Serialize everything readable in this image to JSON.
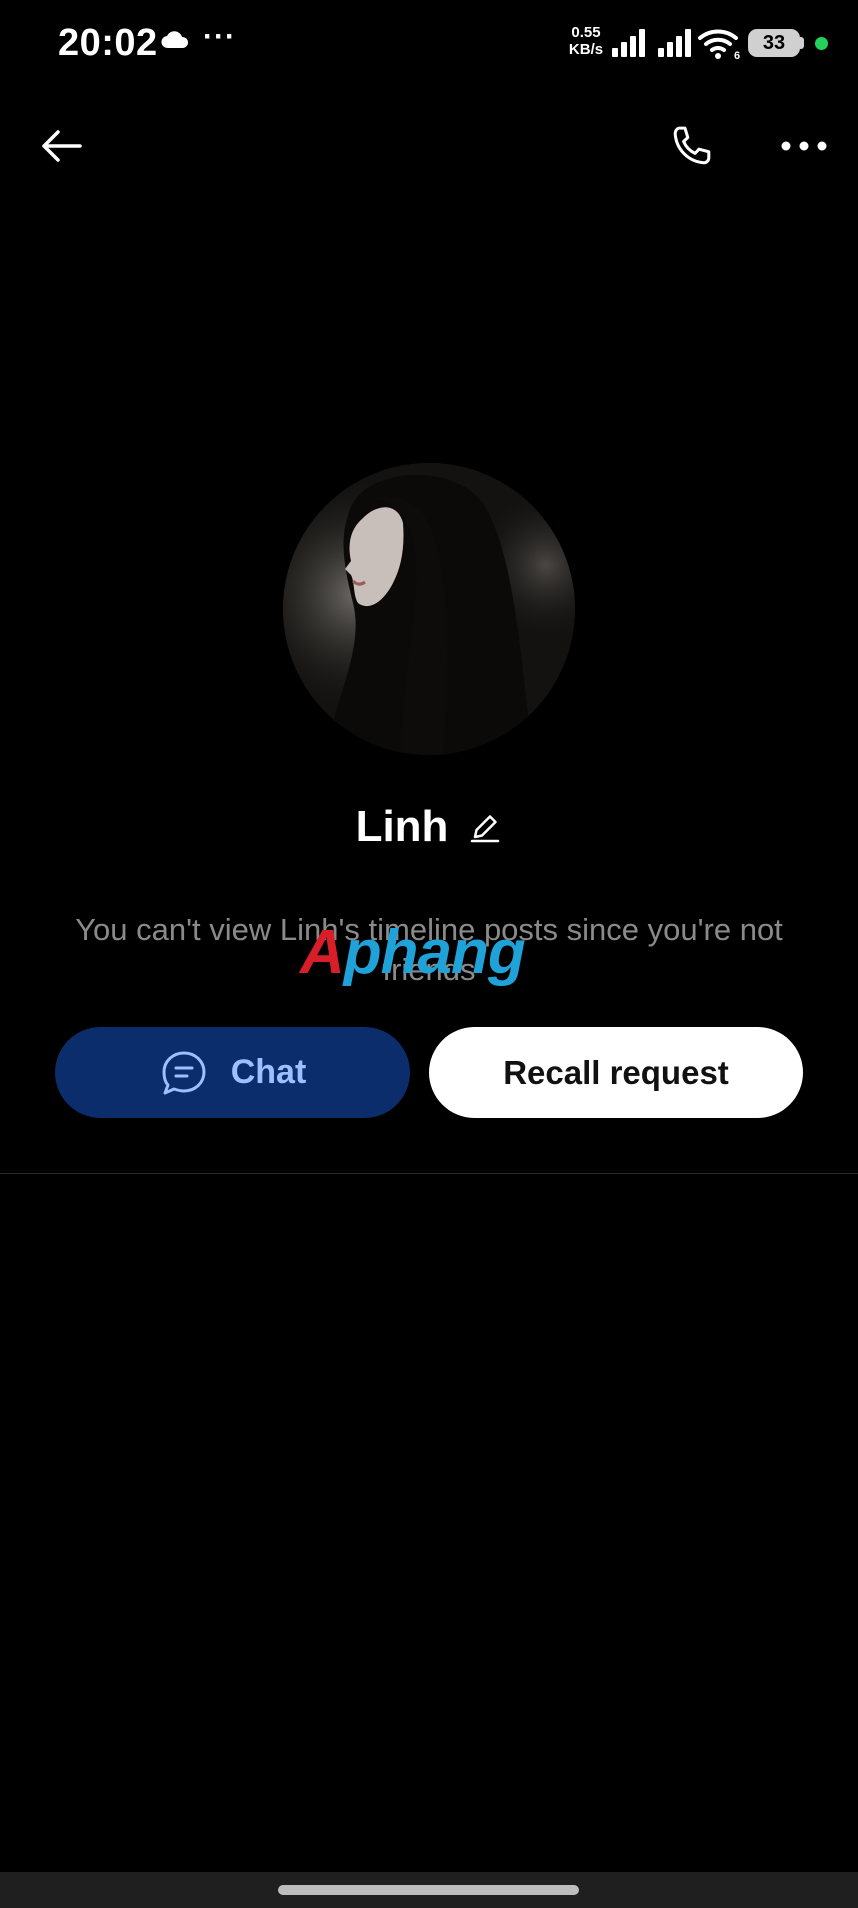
{
  "status_bar": {
    "time": "20:02",
    "more_indicator": "···",
    "net_speed": "0.55",
    "net_speed_unit": "KB/s",
    "battery": "33",
    "wifi_badge": "6",
    "icons": [
      "cloud-icon",
      "signal-icon",
      "signal-icon",
      "wifi-icon",
      "battery-icon"
    ]
  },
  "nav": {
    "back_icon": "arrow-left-icon",
    "call_icon": "phone-icon",
    "more_icon": "more-horizontal-icon"
  },
  "profile": {
    "name": "Linh",
    "edit_icon": "pencil-icon"
  },
  "notice": {
    "text": "You can't view Linh's timeline posts since you're not friends"
  },
  "watermark": {
    "text": "Aphang"
  },
  "actions": {
    "chat_label": "Chat",
    "chat_icon": "chat-bubble-icon",
    "recall_label": "Recall request"
  },
  "colors": {
    "background": "#000000",
    "chat_button_bg": "#0c2d6b",
    "chat_button_text": "#9cc0ff",
    "recall_button_bg": "#ffffff",
    "notice_text": "#8a8a8a",
    "battery_dot": "#23d25a"
  }
}
